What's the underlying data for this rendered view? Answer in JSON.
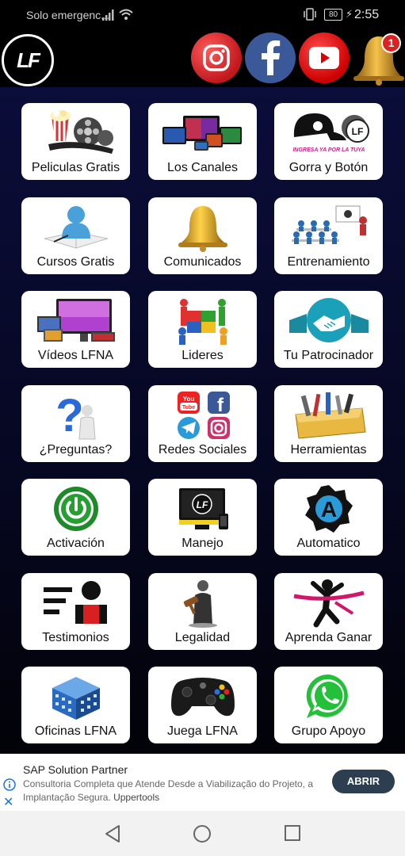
{
  "status_bar": {
    "carrier": "Solo emergenc...",
    "battery": "80",
    "time": "2:55"
  },
  "header": {
    "logo_text": "LF",
    "notification_count": "1",
    "icons": [
      "instagram-icon",
      "facebook-icon",
      "youtube-icon",
      "bell-icon"
    ]
  },
  "tiles": [
    {
      "label": "Peliculas Gratis",
      "icon": "movie-reel-icon"
    },
    {
      "label": "Los Canales",
      "icon": "tv-screens-icon"
    },
    {
      "label": "Gorra y Botón",
      "icon": "cap-button-icon",
      "art_text": "INGRESA YA POR LA TUYA"
    },
    {
      "label": "Cursos Gratis",
      "icon": "student-book-icon"
    },
    {
      "label": "Comunicados",
      "icon": "bell-icon"
    },
    {
      "label": "Entrenamiento",
      "icon": "classroom-icon"
    },
    {
      "label": "Vídeos LFNA",
      "icon": "video-monitor-icon"
    },
    {
      "label": "Lideres",
      "icon": "puzzle-team-icon"
    },
    {
      "label": "Tu Patrocinador",
      "icon": "handshake-icon"
    },
    {
      "label": "¿Preguntas?",
      "icon": "question-person-icon"
    },
    {
      "label": "Redes Sociales",
      "icon": "social-networks-icon"
    },
    {
      "label": "Herramientas",
      "icon": "toolbox-icon"
    },
    {
      "label": "Activación",
      "icon": "power-icon"
    },
    {
      "label": "Manejo",
      "icon": "computer-icon"
    },
    {
      "label": "Automatico",
      "icon": "automatic-a-icon"
    },
    {
      "label": "Testimonios",
      "icon": "testimonial-icon"
    },
    {
      "label": "Legalidad",
      "icon": "judge-gavel-icon"
    },
    {
      "label": "Aprenda Ganar",
      "icon": "winner-ribbon-icon"
    },
    {
      "label": "Oficinas LFNA",
      "icon": "office-building-icon"
    },
    {
      "label": "Juega LFNA",
      "icon": "gamepad-icon"
    },
    {
      "label": "Grupo Apoyo",
      "icon": "whatsapp-icon"
    }
  ],
  "ad": {
    "title": "SAP Solution Partner",
    "description": "Consultoria Completa que Atende Desde a Viabilização do Projeto, a Implantação Segura.",
    "advertiser": "Uppertools",
    "button": "ABRIR"
  },
  "nav": {
    "icons": [
      "back-icon",
      "home-icon",
      "recents-icon"
    ]
  },
  "colors": {
    "grid_background": "#0b0d3a",
    "ad_button": "#2c3e50",
    "badge": "#e02020"
  }
}
